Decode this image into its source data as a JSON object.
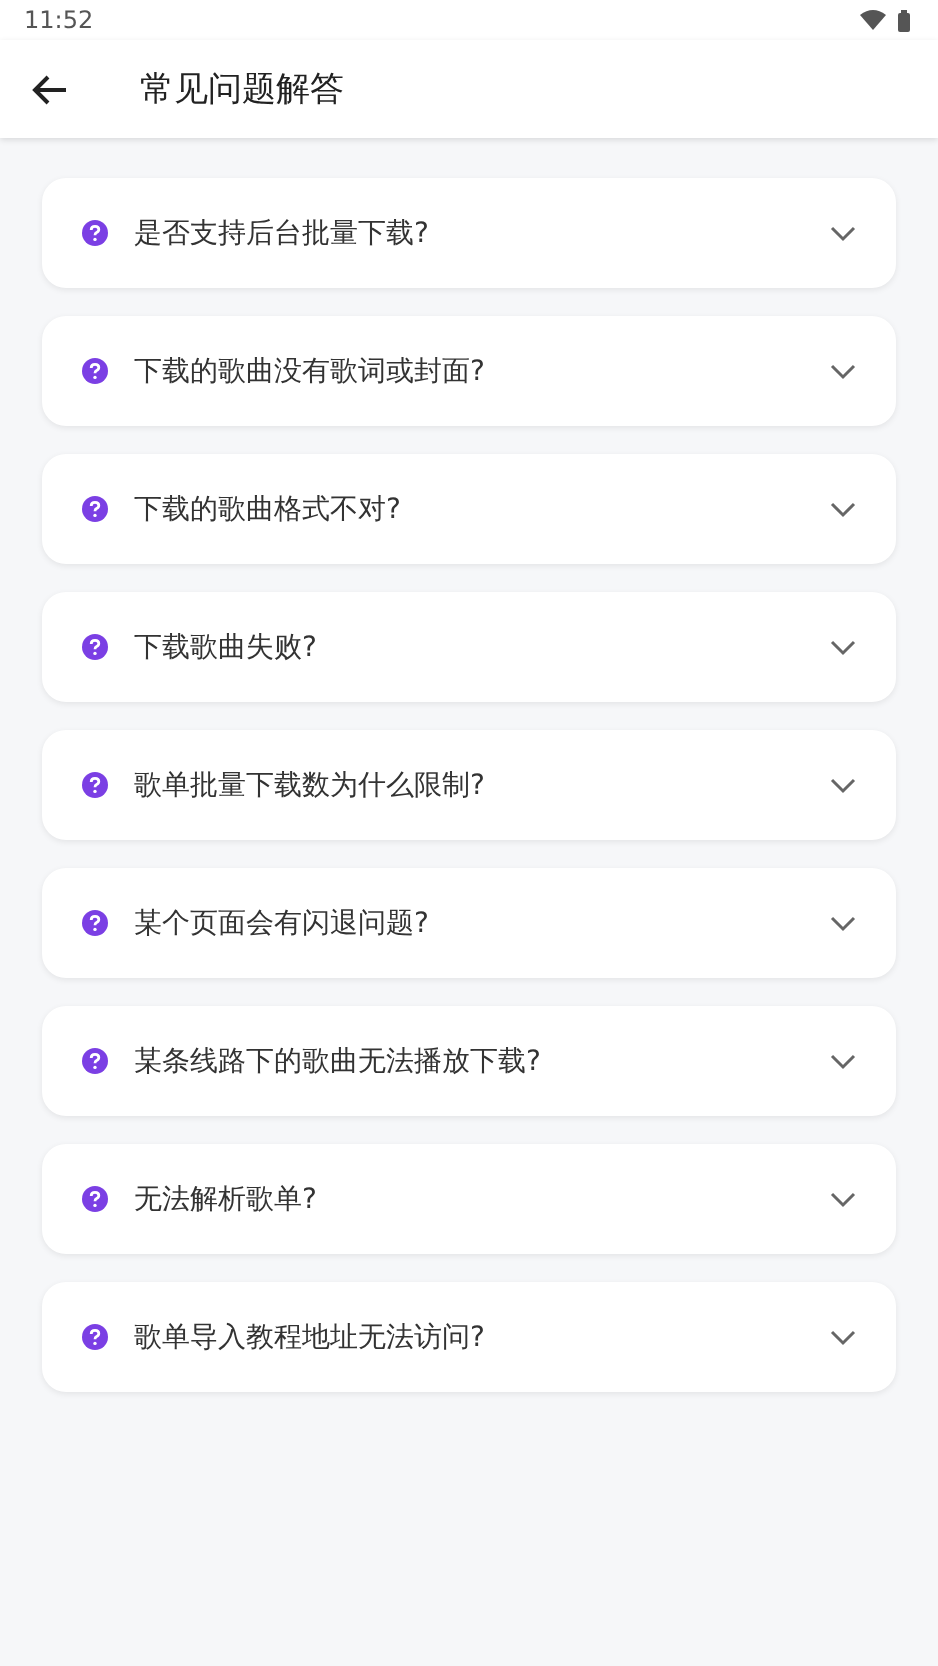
{
  "status_bar": {
    "time": "11:52"
  },
  "app_bar": {
    "title": "常见问题解答"
  },
  "faq": [
    {
      "question": "是否支持后台批量下载?",
      "expanded": false
    },
    {
      "question": "下载的歌曲没有歌词或封面?",
      "expanded": false
    },
    {
      "question": "下载的歌曲格式不对?",
      "expanded": false
    },
    {
      "question": "下载歌曲失败?",
      "expanded": false
    },
    {
      "question": "歌单批量下载数为什么限制?",
      "expanded": false
    },
    {
      "question": "某个页面会有闪退问题?",
      "expanded": false
    },
    {
      "question": "某条线路下的歌曲无法播放下载?",
      "expanded": false
    },
    {
      "question": "无法解析歌单?",
      "expanded": false
    },
    {
      "question": "歌单导入教程地址无法访问?",
      "expanded": false
    }
  ]
}
